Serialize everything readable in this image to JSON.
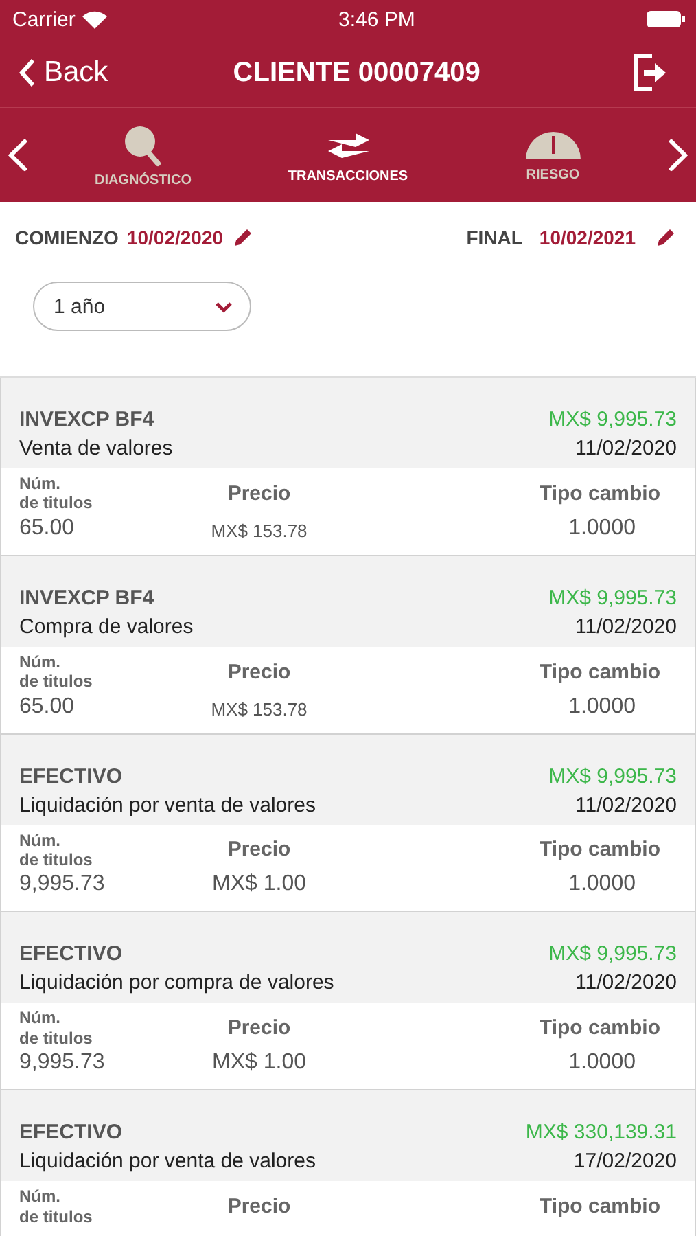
{
  "status_bar": {
    "carrier": "Carrier",
    "time": "3:46 PM"
  },
  "nav": {
    "back": "Back",
    "title": "CLIENTE 00007409"
  },
  "tabs": [
    {
      "label": "DIAGNÓSTICO",
      "kind": "search",
      "selected": false
    },
    {
      "label": "TRANSACCIONES",
      "kind": "transfer",
      "selected": true
    },
    {
      "label": "RIESGO",
      "kind": "gauge",
      "selected": false
    }
  ],
  "dates": {
    "start_label": "COMIENZO",
    "start": "10/02/2020",
    "end_label": "FINAL",
    "end": "10/02/2021"
  },
  "period": {
    "value": "1 año"
  },
  "transactions": [
    {
      "name": "INVEXCP BF4",
      "amount": "MX$ 9,995.73",
      "type": "Venta de valores",
      "date": "11/02/2020",
      "qty_header": "Núm.\nde titulos",
      "price_header": "Precio",
      "rate_header": "Tipo cambio",
      "qty": "65.00",
      "price": "MX$ 153.78",
      "rate": "1.0000",
      "small_price": true
    },
    {
      "name": "INVEXCP BF4",
      "amount": "MX$ 9,995.73",
      "type": "Compra de valores",
      "date": "11/02/2020",
      "qty_header": "Núm.\nde titulos",
      "price_header": "Precio",
      "rate_header": "Tipo cambio",
      "qty": "65.00",
      "price": "MX$ 153.78",
      "rate": "1.0000",
      "small_price": true
    },
    {
      "name": "EFECTIVO",
      "amount": "MX$ 9,995.73",
      "type": "Liquidación por venta de valores",
      "date": "11/02/2020",
      "qty_header": "Núm.\nde titulos",
      "price_header": "Precio",
      "rate_header": "Tipo cambio",
      "qty": "9,995.73",
      "price": "MX$ 1.00",
      "rate": "1.0000",
      "small_price": false
    },
    {
      "name": "EFECTIVO",
      "amount": "MX$ 9,995.73",
      "type": "Liquidación por compra de valores",
      "date": "11/02/2020",
      "qty_header": "Núm.\nde titulos",
      "price_header": "Precio",
      "rate_header": "Tipo cambio",
      "qty": "9,995.73",
      "price": "MX$ 1.00",
      "rate": "1.0000",
      "small_price": false
    },
    {
      "name": "EFECTIVO",
      "amount": "MX$ 330,139.31",
      "type": "Liquidación por venta de valores",
      "date": "17/02/2020",
      "qty_header": "Núm.\nde titulos",
      "price_header": "Precio",
      "rate_header": "Tipo cambio"
    }
  ]
}
